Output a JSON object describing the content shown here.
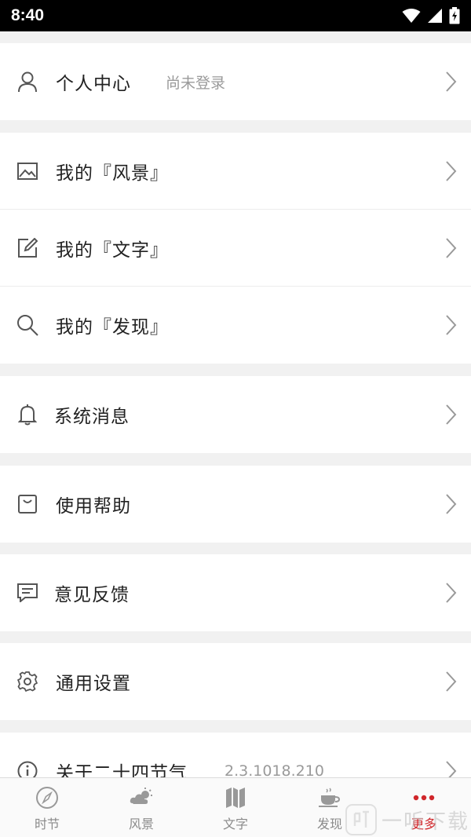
{
  "status_bar": {
    "time": "8:40"
  },
  "menu": {
    "profile": {
      "label": "个人中心",
      "status": "尚未登录"
    },
    "scenery": {
      "label": "我的『风景』"
    },
    "text": {
      "label": "我的『文字』"
    },
    "discover": {
      "label": "我的『发现』"
    },
    "messages": {
      "label": "系统消息"
    },
    "help": {
      "label": "使用帮助"
    },
    "feedback": {
      "label": "意见反馈"
    },
    "settings": {
      "label": "通用设置"
    },
    "about": {
      "label": "关于二十四节气",
      "version": "2.3.1018.210"
    }
  },
  "tabs": [
    {
      "label": "时节",
      "icon": "compass-icon"
    },
    {
      "label": "风景",
      "icon": "cloud-sun-icon"
    },
    {
      "label": "文字",
      "icon": "map-icon"
    },
    {
      "label": "发现",
      "icon": "teacup-icon"
    },
    {
      "label": "更多",
      "icon": "more-dots-icon",
      "active": true
    }
  ],
  "watermark": {
    "text": "一听下载"
  },
  "colors": {
    "accent": "#d0262a",
    "background": "#f1f1f1",
    "statusbar": "#000000"
  }
}
